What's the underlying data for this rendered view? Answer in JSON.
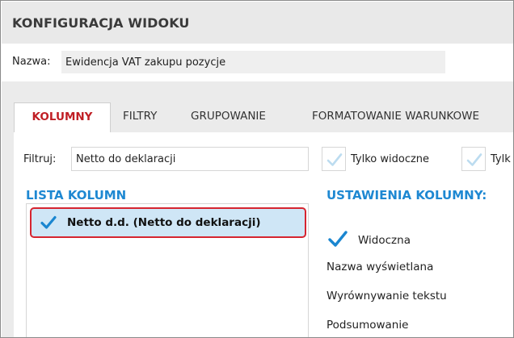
{
  "window": {
    "title": "KONFIGURACJA WIDOKU"
  },
  "name_field": {
    "label": "Nazwa:",
    "value": "Ewidencja VAT zakupu pozycje"
  },
  "tabs": [
    {
      "label": "KOLUMNY",
      "active": true
    },
    {
      "label": "FILTRY",
      "active": false
    },
    {
      "label": "GRUPOWANIE",
      "active": false
    },
    {
      "label": "FORMATOWANIE WARUNKOWE",
      "active": false
    }
  ],
  "filter": {
    "label": "Filtruj:",
    "value": "Netto do deklaracji",
    "options": [
      {
        "label": "Tylko widoczne",
        "checked": false
      },
      {
        "label": "Tylk",
        "checked": false
      }
    ]
  },
  "column_list": {
    "title": "LISTA KOLUMN",
    "items": [
      {
        "label": "Netto d.d. (Netto do deklaracji)",
        "checked": true,
        "selected": true
      }
    ]
  },
  "column_settings": {
    "title": "USTAWIENIA KOLUMNY:",
    "visible": {
      "label": "Widoczna",
      "checked": true
    },
    "fields": [
      {
        "label": "Nazwa wyświetlana"
      },
      {
        "label": "Wyrównywanie tekstu"
      },
      {
        "label": "Podsumowanie"
      }
    ]
  },
  "colors": {
    "accent_blue": "#1e88d2",
    "active_tab_red": "#c01e24",
    "selection_border": "#d62530",
    "selection_fill": "#cfe6f6",
    "check_blue": "#1a86d0"
  }
}
